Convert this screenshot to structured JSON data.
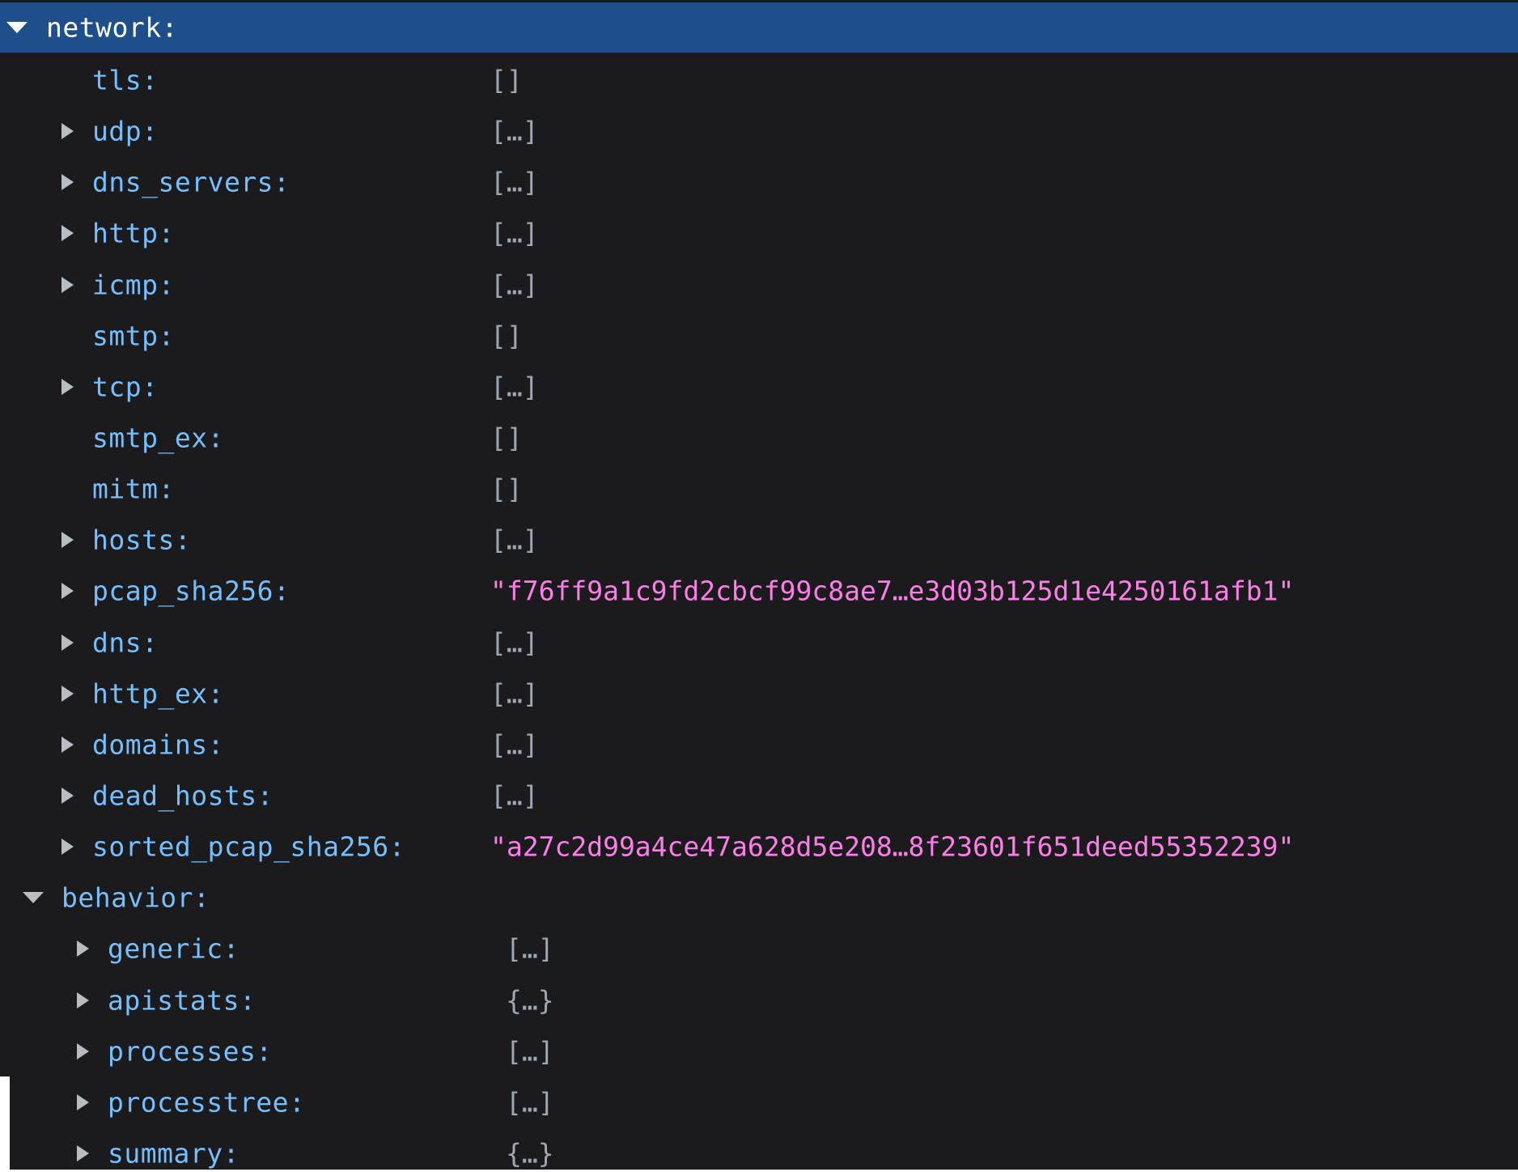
{
  "tree": {
    "network": {
      "key": "network:",
      "expanded": true,
      "selected": true,
      "children": [
        {
          "key": "tls:",
          "value": "[]",
          "expandable": false
        },
        {
          "key": "udp:",
          "value": "[…]",
          "expandable": true
        },
        {
          "key": "dns_servers:",
          "value": "[…]",
          "expandable": true
        },
        {
          "key": "http:",
          "value": "[…]",
          "expandable": true
        },
        {
          "key": "icmp:",
          "value": "[…]",
          "expandable": true
        },
        {
          "key": "smtp:",
          "value": "[]",
          "expandable": false
        },
        {
          "key": "tcp:",
          "value": "[…]",
          "expandable": true
        },
        {
          "key": "smtp_ex:",
          "value": "[]",
          "expandable": false
        },
        {
          "key": "mitm:",
          "value": "[]",
          "expandable": false
        },
        {
          "key": "hosts:",
          "value": "[…]",
          "expandable": true
        },
        {
          "key": "pcap_sha256:",
          "value": "\"f76ff9a1c9fd2cbcf99c8ae7…e3d03b125d1e4250161afb1\"",
          "expandable": true,
          "type": "string"
        },
        {
          "key": "dns:",
          "value": "[…]",
          "expandable": true
        },
        {
          "key": "http_ex:",
          "value": "[…]",
          "expandable": true
        },
        {
          "key": "domains:",
          "value": "[…]",
          "expandable": true
        },
        {
          "key": "dead_hosts:",
          "value": "[…]",
          "expandable": true
        },
        {
          "key": "sorted_pcap_sha256:",
          "value": "\"a27c2d99a4ce47a628d5e208…8f23601f651deed55352239\"",
          "expandable": true,
          "type": "string"
        }
      ]
    },
    "behavior": {
      "key": "behavior:",
      "expanded": true,
      "children": [
        {
          "key": "generic:",
          "value": "[…]",
          "expandable": true
        },
        {
          "key": "apistats:",
          "value": "{…}",
          "expandable": true
        },
        {
          "key": "processes:",
          "value": "[…]",
          "expandable": true
        },
        {
          "key": "processtree:",
          "value": "[…]",
          "expandable": true
        },
        {
          "key": "summary:",
          "value": "{…}",
          "expandable": true
        }
      ]
    }
  },
  "colors": {
    "background": "#1b1b1d",
    "selected_row": "#1f4f8a",
    "key": "#75bfff",
    "value": "#9fa6b0",
    "string_value": "#ff7de9",
    "twisty": "#b9bcc2"
  }
}
